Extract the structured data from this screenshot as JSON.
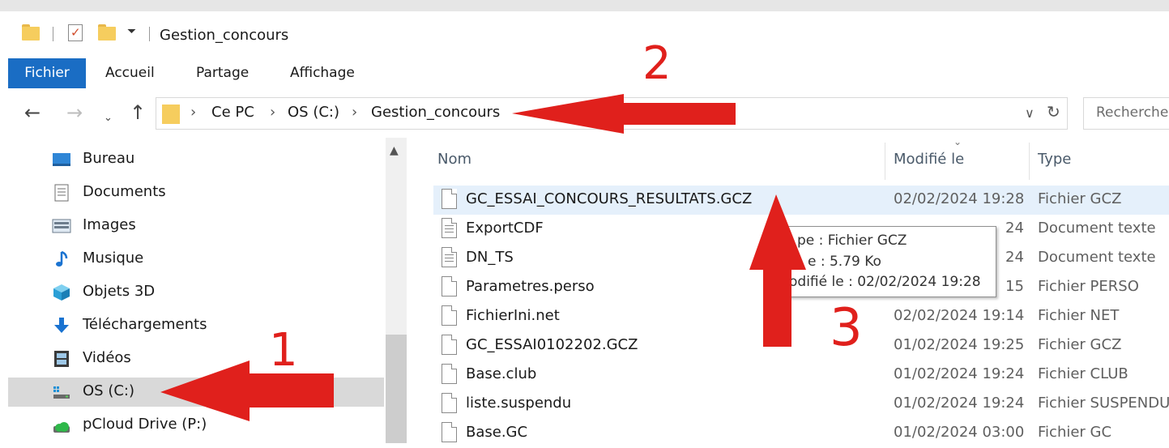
{
  "window": {
    "title": "Gestion_concours"
  },
  "ribbon": {
    "tabs": [
      "Fichier",
      "Accueil",
      "Partage",
      "Affichage"
    ]
  },
  "address": {
    "crumbs": [
      "Ce PC",
      "OS (C:)",
      "Gestion_concours"
    ],
    "search_placeholder": "Recherche"
  },
  "nav": {
    "items": [
      {
        "label": "Bureau",
        "icon": "desktop-icon"
      },
      {
        "label": "Documents",
        "icon": "documents-icon"
      },
      {
        "label": "Images",
        "icon": "pictures-icon"
      },
      {
        "label": "Musique",
        "icon": "music-icon"
      },
      {
        "label": "Objets 3D",
        "icon": "3d-objects-icon"
      },
      {
        "label": "Téléchargements",
        "icon": "downloads-icon"
      },
      {
        "label": "Vidéos",
        "icon": "videos-icon"
      },
      {
        "label": "OS (C:)",
        "icon": "drive-icon",
        "selected": true
      },
      {
        "label": "pCloud Drive (P:)",
        "icon": "cloud-drive-icon"
      }
    ]
  },
  "files": {
    "columns": [
      "Nom",
      "Modifié le",
      "Type"
    ],
    "rows": [
      {
        "name": "GC_ESSAI_CONCOURS_RESULTATS.GCZ",
        "date": "02/02/2024 19:28",
        "type": "Fichier GCZ",
        "icon": "generic-file-icon"
      },
      {
        "name": "ExportCDF",
        "date": "",
        "type": "Document texte",
        "icon": "text-file-icon"
      },
      {
        "name": "DN_TS",
        "date": "",
        "type": "Document texte",
        "icon": "text-file-icon"
      },
      {
        "name": "Parametres.perso",
        "date": "",
        "type": "Fichier PERSO",
        "icon": "generic-file-icon"
      },
      {
        "name": "FichierIni.net",
        "date": "02/02/2024 19:14",
        "type": "Fichier NET",
        "icon": "generic-file-icon"
      },
      {
        "name": "GC_ESSAI0102202.GCZ",
        "date": "01/02/2024 19:25",
        "type": "Fichier GCZ",
        "icon": "generic-file-icon"
      },
      {
        "name": "Base.club",
        "date": "01/02/2024 19:24",
        "type": "Fichier CLUB",
        "icon": "generic-file-icon"
      },
      {
        "name": "liste.suspendu",
        "date": "01/02/2024 19:24",
        "type": "Fichier SUSPENDU",
        "icon": "generic-file-icon"
      },
      {
        "name": "Base.GC",
        "date": "01/02/2024 03:00",
        "type": "Fichier GC",
        "icon": "generic-file-icon"
      }
    ],
    "partial_dates": [
      "24",
      "24",
      "15"
    ]
  },
  "tooltip": {
    "lines": [
      "pe : Fichier GCZ",
      "e : 5.79 Ko",
      "odifié le : 02/02/2024 19:28"
    ]
  },
  "annotations": {
    "color": "#e0201c",
    "numbers": [
      "1",
      "2",
      "3"
    ]
  }
}
